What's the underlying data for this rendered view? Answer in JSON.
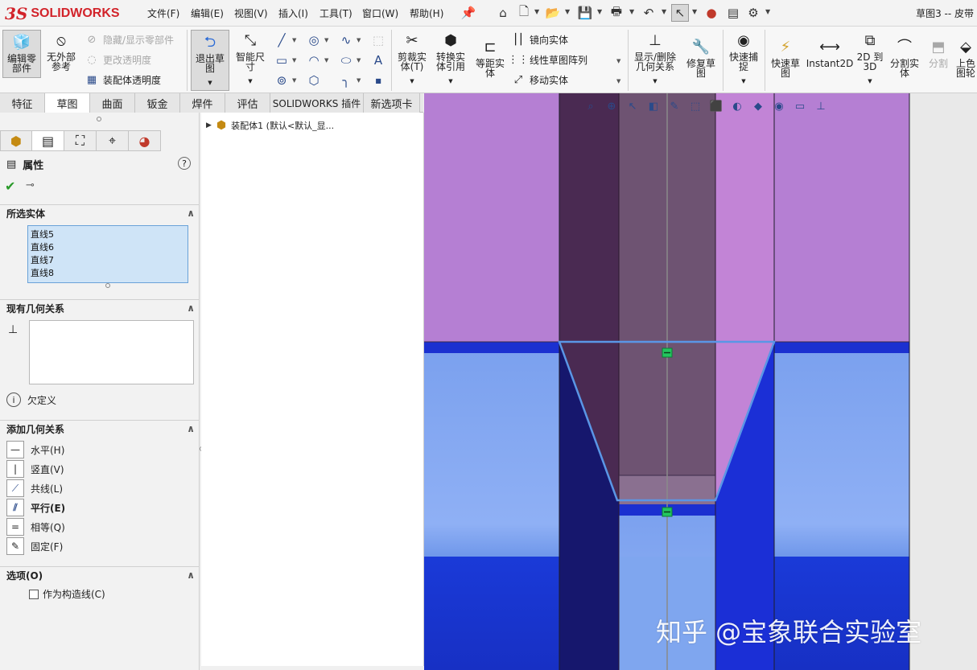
{
  "app": {
    "logo_ds": "3S",
    "logo_text": "SOLIDWORKS",
    "document_title": "草图3 -- 皮带"
  },
  "menu": [
    {
      "label": "文件(F)"
    },
    {
      "label": "编辑(E)"
    },
    {
      "label": "视图(V)"
    },
    {
      "label": "插入(I)"
    },
    {
      "label": "工具(T)"
    },
    {
      "label": "窗口(W)"
    },
    {
      "label": "帮助(H)"
    }
  ],
  "ribbon": {
    "edit_part": "编辑零\n部件",
    "no_external_ref": "无外部\n参考",
    "hide_show_components": "隐藏/显示零部件",
    "change_transparency": "更改透明度",
    "assembly_transparency": "装配体透明度",
    "exit_sketch": "退出草\n图",
    "smart_dimension": "智能尺\n寸",
    "trim_entities": "剪裁实\n体(T)",
    "convert_entities": "转换实\n体引用",
    "offset_entities": "等距实\n体",
    "mirror_entities": "镜向实体",
    "linear_pattern": "线性草图阵列",
    "move_entities": "移动实体",
    "display_delete_relations": "显示/删除\n几何关系",
    "repair_sketch": "修复草\n图",
    "quick_snaps": "快速捕\n捉",
    "rapid_sketch": "快速草\n图",
    "instant2d": "Instant2D",
    "to_3d": "2D 到\n3D",
    "split_entities": "分割实\n体",
    "split": "分割",
    "top_color": "上色\n图轮"
  },
  "tabs": [
    {
      "label": "特征",
      "active": false
    },
    {
      "label": "草图",
      "active": true
    },
    {
      "label": "曲面",
      "active": false
    },
    {
      "label": "钣金",
      "active": false
    },
    {
      "label": "焊件",
      "active": false
    },
    {
      "label": "评估",
      "active": false
    },
    {
      "label": "SOLIDWORKS 插件",
      "active": false
    },
    {
      "label": "新选项卡",
      "active": false
    }
  ],
  "property_manager": {
    "title": "属性",
    "selected_entities_header": "所选实体",
    "selected_entities": [
      "直线5",
      "直线6",
      "直线7",
      "直线8"
    ],
    "existing_relations_header": "现有几何关系",
    "status": "欠定义",
    "add_relations_header": "添加几何关系",
    "add_relations": [
      {
        "label": "水平(H)",
        "icon": "horizontal-icon"
      },
      {
        "label": "竖直(V)",
        "icon": "vertical-icon"
      },
      {
        "label": "共线(L)",
        "icon": "collinear-icon"
      },
      {
        "label": "平行(E)",
        "icon": "parallel-icon"
      },
      {
        "label": "相等(Q)",
        "icon": "equal-icon"
      },
      {
        "label": "固定(F)",
        "icon": "fix-icon"
      }
    ],
    "options_header": "选项(O)",
    "construction_label": "作为构造线(C)",
    "construction_checked": false
  },
  "feature_tree": {
    "root_label": "装配体1 (默认<默认_显..."
  },
  "viewport": {
    "watermark": "知乎 @宝象联合实验室"
  },
  "colors": {
    "purple": "#b57fd3",
    "dark_purple": "#4a2a52",
    "mid_purple": "#6e5372",
    "blue": "#7fa6ef",
    "dark_blue": "#16176d",
    "bright_blue": "#1b2fd6",
    "sketch_line": "#5a96e6",
    "relation_marker": "#22c55e"
  }
}
